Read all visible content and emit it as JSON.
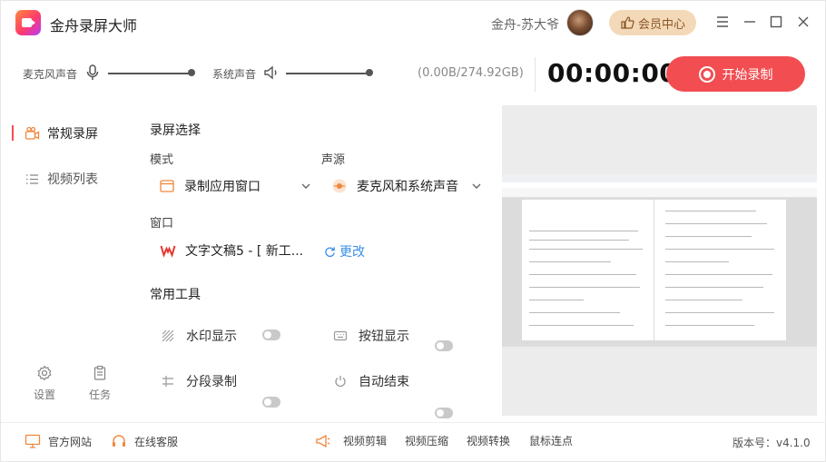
{
  "app": {
    "title": "金舟录屏大师"
  },
  "user": {
    "name": "金舟-苏大爷",
    "vip_label": "会员中心"
  },
  "audio": {
    "mic_label": "麦克风声音",
    "system_label": "系统声音",
    "mic_level": 1.0,
    "system_level": 1.0
  },
  "storage": "(0.00B/274.92GB)",
  "timer": "00:00:00",
  "record_button": "开始录制",
  "sidebar": {
    "items": [
      {
        "label": "常规录屏",
        "icon": "camera-icon",
        "active": true
      },
      {
        "label": "视频列表",
        "icon": "list-icon",
        "active": false
      }
    ],
    "bottom": [
      {
        "label": "设置",
        "icon": "gear-icon"
      },
      {
        "label": "任务",
        "icon": "clipboard-icon"
      }
    ]
  },
  "main": {
    "section_title": "录屏选择",
    "mode_label": "模式",
    "mode_value": "录制应用窗口",
    "source_label": "声源",
    "source_value": "麦克风和系统声音",
    "window_label": "窗口",
    "window_value": "文字文稿5 - [ 新工...",
    "change_label": "更改",
    "tools_title": "常用工具",
    "tools": [
      {
        "label": "水印显示",
        "icon": "watermark-icon",
        "on": false
      },
      {
        "label": "按钮显示",
        "icon": "keyboard-icon",
        "on": false
      },
      {
        "label": "分段录制",
        "icon": "segment-icon",
        "on": false
      },
      {
        "label": "自动结束",
        "icon": "power-icon",
        "on": false
      }
    ]
  },
  "footer": {
    "website": "官方网站",
    "support": "在线客服",
    "links": [
      "视频剪辑",
      "视频压缩",
      "视频转换",
      "鼠标连点"
    ],
    "version": "版本号：v4.1.0"
  },
  "colors": {
    "accent": "#f24e52",
    "vip_bg": "#f3d9b8",
    "link": "#3a8ee6"
  }
}
